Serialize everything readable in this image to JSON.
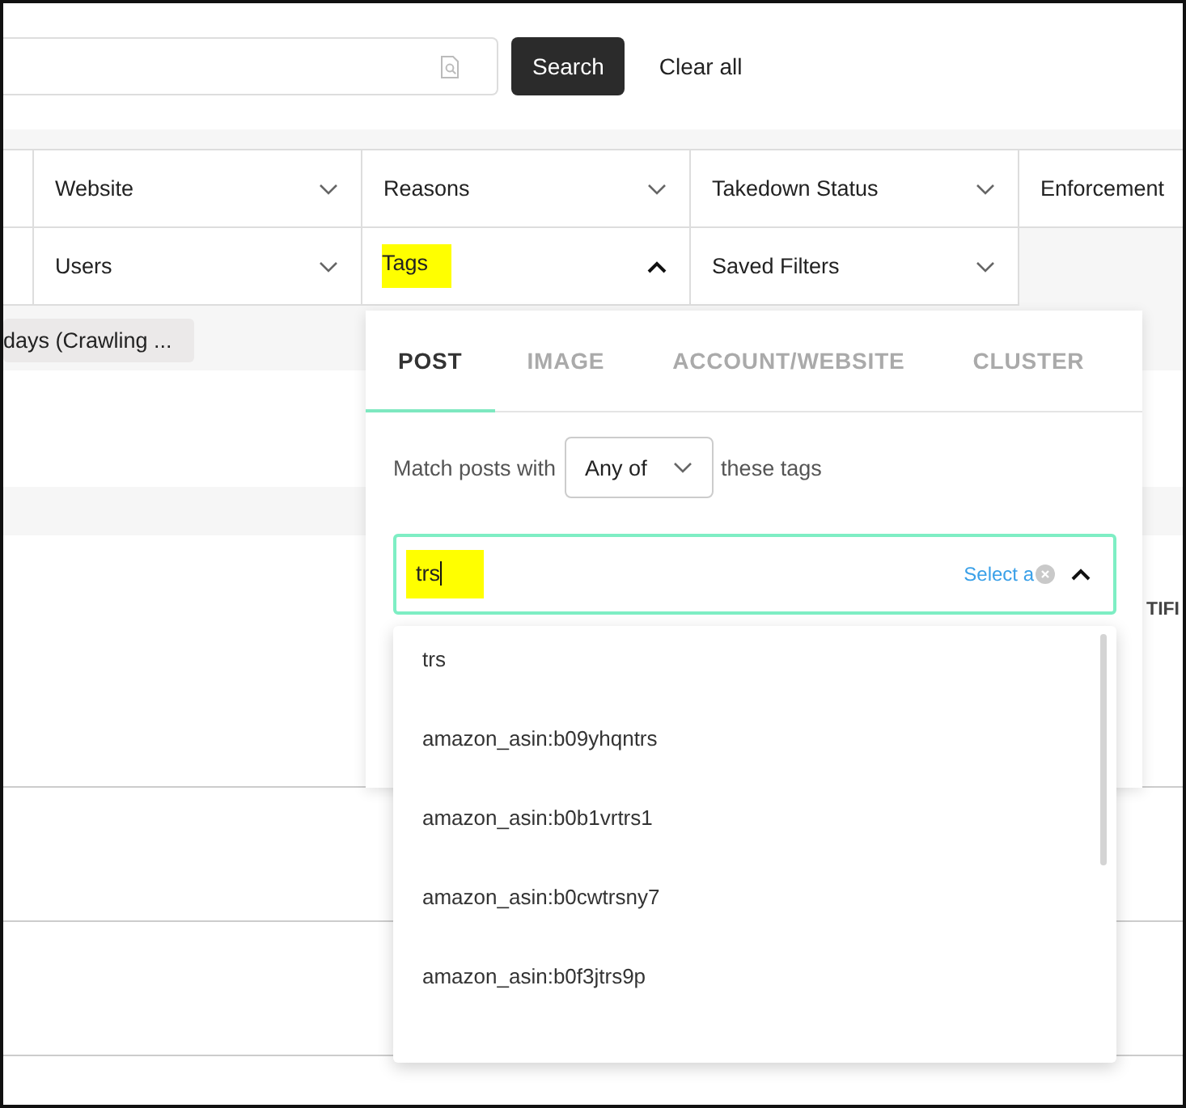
{
  "search_bar": {
    "button": "Search",
    "clear": "Clear all"
  },
  "filters": [
    [
      {
        "label": "Website",
        "expanded": false,
        "highlighted": false
      },
      {
        "label": "Reasons",
        "expanded": false,
        "highlighted": false
      },
      {
        "label": "Takedown Status",
        "expanded": false,
        "highlighted": false
      },
      {
        "label": "Enforcement",
        "highlighted": false
      }
    ],
    [
      {
        "label": "Users",
        "expanded": false,
        "highlighted": false
      },
      {
        "label": "Tags",
        "expanded": true,
        "highlighted": true
      },
      {
        "label": "Saved Filters",
        "expanded": false,
        "highlighted": false
      }
    ]
  ],
  "chips": [
    "days (Crawling ..."
  ],
  "table": {
    "column_fragment": "TIFI"
  },
  "tags_popover": {
    "tabs": [
      {
        "label": "POST",
        "selected": true
      },
      {
        "label": "IMAGE",
        "selected": false
      },
      {
        "label": "ACCOUNT/WEBSITE",
        "selected": false
      },
      {
        "label": "CLUSTER",
        "selected": false
      }
    ],
    "match": {
      "prefix": "Match posts with",
      "mode": "Any of",
      "suffix": "these tags"
    },
    "tag_input": {
      "value": "trs",
      "highlighted": true,
      "select_all": "Select a",
      "expanded": true
    },
    "options": [
      "trs",
      "amazon_asin:b09yhqntrs",
      "amazon_asin:b0b1vrtrs1",
      "amazon_asin:b0cwtrsny7",
      "amazon_asin:b0f3jtrs9p"
    ]
  }
}
